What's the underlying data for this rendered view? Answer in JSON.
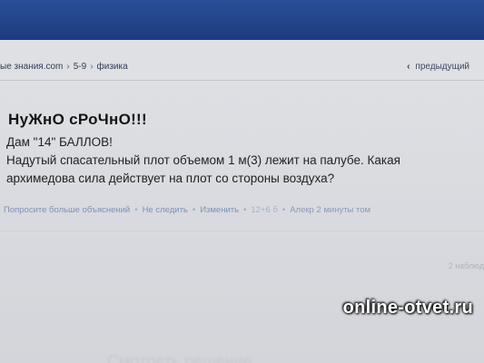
{
  "breadcrumb": {
    "site": "ые знания.com",
    "grade": "5-9",
    "subject": "физика"
  },
  "nav": {
    "prev_label": "предыдущий"
  },
  "question": {
    "title": "НуЖнО сРоЧнО!!!",
    "lines": [
      "Дам \"14\" БАЛЛОВ!",
      "Надутый спасательный плот объемом 1 м(3) лежит на палубе. Какая",
      "архимедова сила действует на плот со стороны воздуха?"
    ]
  },
  "actions": {
    "ask_more": "Попросите больше объяснений",
    "unfollow": "Не следить",
    "edit": "Изменить",
    "points": "12+6 б",
    "author": "Алекр 2 минуты том"
  },
  "observers_text": "2 наблюд",
  "bottom_faded_text": "Смотреть решение",
  "watermark": "online-otvet.ru"
}
